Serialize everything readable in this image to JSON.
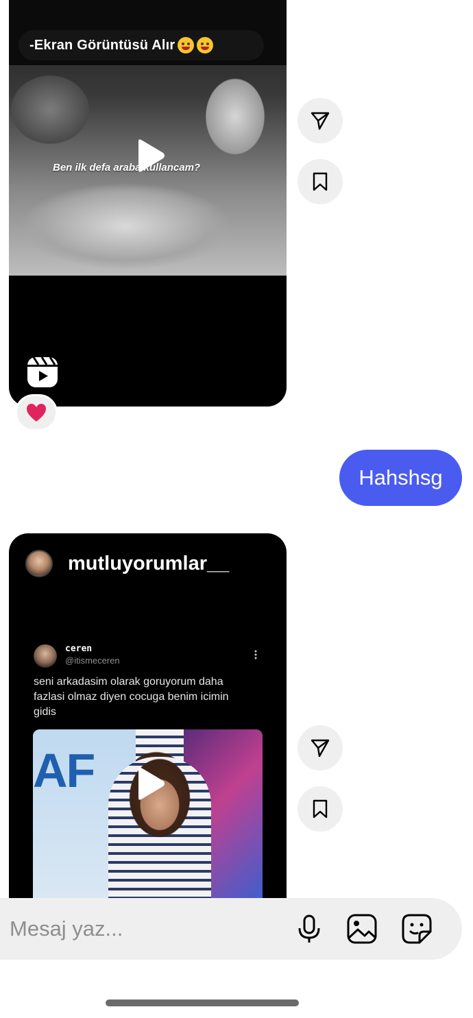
{
  "reel_1": {
    "caption": "-Ekran Görüntüsü Alır",
    "subtitle": "Ben ilk defa araba kullancam?",
    "reaction": "❤️"
  },
  "outgoing_message": {
    "text": "Hahshsg"
  },
  "shared_post": {
    "username": "mutluyorumlar__",
    "tweet": {
      "name": "ceren",
      "handle": "@itismeceren",
      "text": "seni arkadasim olarak goruyorum daha fazlasi olmaz diyen cocuga benim icimin gidis",
      "media_text": "AF"
    }
  },
  "composer": {
    "placeholder": "Mesaj yaz..."
  },
  "icons": {
    "share": "paper-plane-icon",
    "save": "bookmark-icon",
    "play": "play-icon",
    "reels": "reels-icon",
    "mic": "microphone-icon",
    "gallery": "image-icon",
    "sticker": "sticker-icon"
  },
  "colors": {
    "outgoing_bubble": "#4a5cf0",
    "card_background": "#000000",
    "button_background": "#efefef",
    "heart": "#e0245e"
  }
}
